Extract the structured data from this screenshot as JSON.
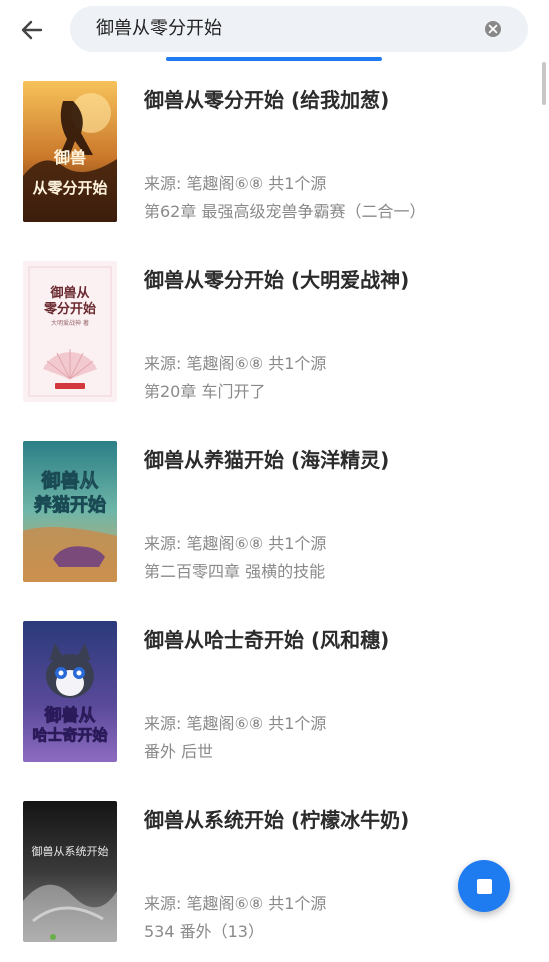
{
  "search": {
    "query": "御兽从零分开始"
  },
  "results": [
    {
      "title": "御兽从零分开始 (给我加葱)",
      "source": "来源: 笔趣阁⑥⑧ 共1个源",
      "chapter": "第62章 最强高级宠兽争霸赛（二合一）",
      "cover_text": [
        "御兽",
        "从零分开始"
      ],
      "cover_colors": [
        "#f0b64a",
        "#6b3a12"
      ]
    },
    {
      "title": "御兽从零分开始 (大明爱战神)",
      "source": "来源: 笔趣阁⑥⑧ 共1个源",
      "chapter": "第20章 车门开了",
      "cover_text": [
        "御兽从",
        "零分开始",
        "大明爱战神 著"
      ],
      "cover_colors": [
        "#fbeff0",
        "#d98c96"
      ]
    },
    {
      "title": "御兽从养猫开始 (海洋精灵)",
      "source": "来源: 笔趣阁⑥⑧ 共1个源",
      "chapter": "第二百零四章 强横的技能",
      "cover_text": [
        "御兽从",
        "养猫开始"
      ],
      "cover_colors": [
        "#2f8c8a",
        "#d9a25a"
      ]
    },
    {
      "title": "御兽从哈士奇开始 (风和穗)",
      "source": "来源: 笔趣阁⑥⑧ 共1个源",
      "chapter": "番外 后世",
      "cover_text": [
        "御兽从",
        "哈士奇开始"
      ],
      "cover_colors": [
        "#2a3a7a",
        "#7d5bb0"
      ]
    },
    {
      "title": "御兽从系统开始 (柠檬冰牛奶)",
      "source": "来源: 笔趣阁⑥⑧ 共1个源",
      "chapter": "534 番外（13）",
      "cover_text": [
        "御兽从系统开始"
      ],
      "cover_colors": [
        "#1a1a1a",
        "#7a7a7a"
      ]
    }
  ],
  "colors": {
    "accent": "#1f7cf0",
    "search_bg": "#eef1f6"
  }
}
